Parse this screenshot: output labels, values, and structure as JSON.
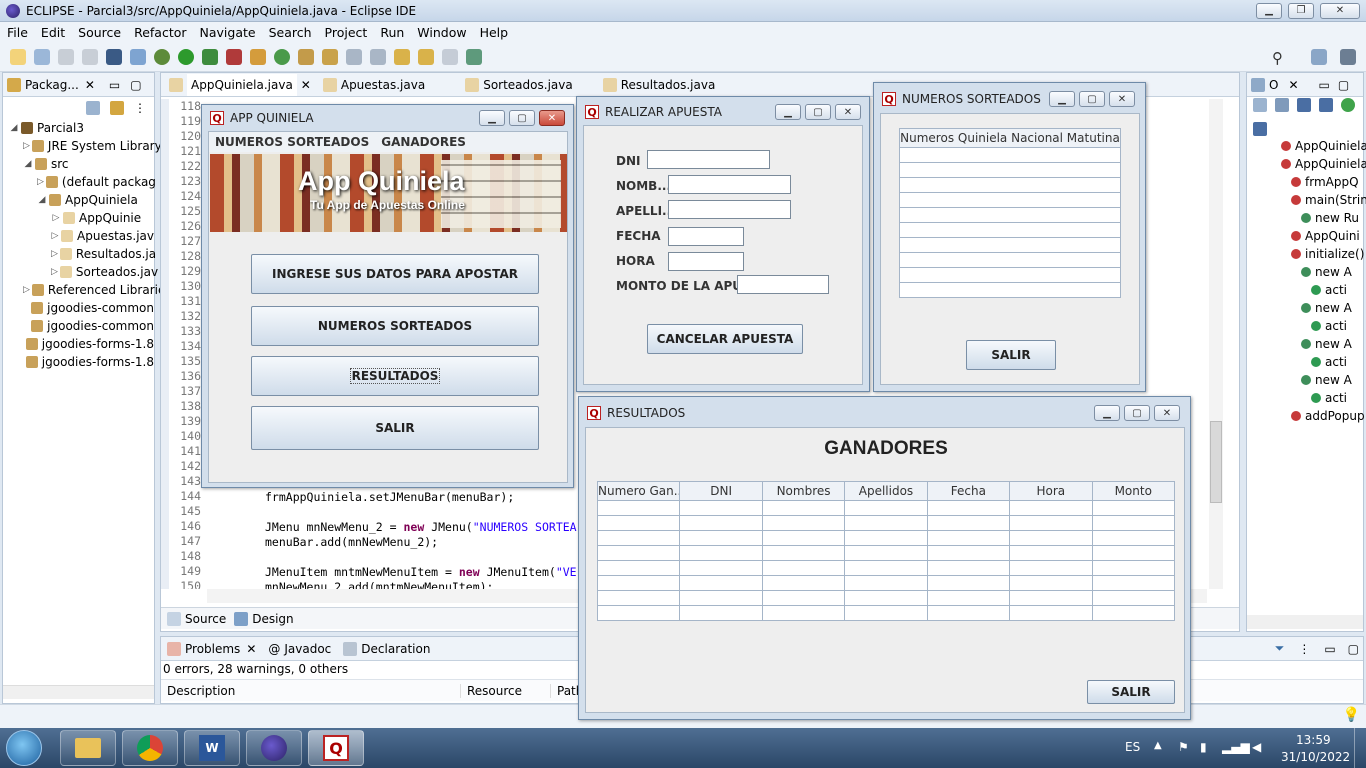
{
  "window": {
    "title": "ECLIPSE - Parcial3/src/AppQuiniela/AppQuiniela.java - Eclipse IDE"
  },
  "menu": [
    "File",
    "Edit",
    "Source",
    "Refactor",
    "Navigate",
    "Search",
    "Project",
    "Run",
    "Window",
    "Help"
  ],
  "package_explorer": {
    "tab": "Packag...",
    "items": [
      {
        "label": "Parcial3",
        "indent": 0,
        "twisty": "◢"
      },
      {
        "label": "JRE System Library",
        "indent": 1,
        "twisty": "▷"
      },
      {
        "label": "src",
        "indent": 1,
        "twisty": "◢"
      },
      {
        "label": "(default packag",
        "indent": 2,
        "twisty": "▷"
      },
      {
        "label": "AppQuiniela",
        "indent": 2,
        "twisty": "◢"
      },
      {
        "label": "AppQuinie",
        "indent": 3,
        "twisty": "▷"
      },
      {
        "label": "Apuestas.jav",
        "indent": 3,
        "twisty": "▷"
      },
      {
        "label": "Resultados.ja",
        "indent": 3,
        "twisty": "▷"
      },
      {
        "label": "Sorteados.jav",
        "indent": 3,
        "twisty": "▷"
      },
      {
        "label": "Referenced Librarie",
        "indent": 1,
        "twisty": "▷"
      },
      {
        "label": "jgoodies-common",
        "indent": 1,
        "twisty": ""
      },
      {
        "label": "jgoodies-common",
        "indent": 1,
        "twisty": ""
      },
      {
        "label": "jgoodies-forms-1.8",
        "indent": 1,
        "twisty": ""
      },
      {
        "label": "jgoodies-forms-1.8",
        "indent": 1,
        "twisty": ""
      }
    ]
  },
  "editor": {
    "tabs": [
      "AppQuiniela.java",
      "Apuestas.java",
      "Sorteados.java",
      "Resultados.java"
    ],
    "line_numbers": [
      "118",
      "119",
      "120",
      "121",
      "122",
      "123",
      "124",
      "125",
      "126",
      "127",
      "128",
      "129",
      "130",
      "131",
      "132",
      "133",
      "134",
      "135",
      "136",
      "137",
      "138",
      "139",
      "140",
      "141",
      "142",
      "143",
      "144",
      "145",
      "146",
      "147",
      "148",
      "149",
      "150"
    ],
    "code": {
      "l144": "frmAppQuiniela.setJMenuBar(menuBar);",
      "l146a": "JMenu mnNewMenu_2 = ",
      "l146b": "new",
      "l146c": " JMenu(",
      "l146d": "\"NUMEROS SORTEA",
      "l147": "menuBar.add(mnNewMenu_2);",
      "l149a": "JMenuItem mntmNewMenuItem = ",
      "l149b": "new",
      "l149c": " JMenuItem(",
      "l149d": "\"VE",
      "l150": "mnNewMenu_2.add(mntmNewMenuItem);"
    },
    "bottom_tabs": [
      "Source",
      "Design"
    ]
  },
  "problems": {
    "tabs": [
      "Problems",
      "Javadoc",
      "Declaration"
    ],
    "summary": "0 errors, 28 warnings, 0 others",
    "columns": [
      "Description",
      "Resource",
      "Path"
    ]
  },
  "outline": {
    "tab": "O",
    "items": [
      {
        "label": "AppQuiniela",
        "indent": 0
      },
      {
        "label": "AppQuiniela",
        "indent": 0
      },
      {
        "label": "frmAppQ",
        "indent": 1
      },
      {
        "label": "main(Strin",
        "indent": 1
      },
      {
        "label": "new Ru",
        "indent": 2
      },
      {
        "label": "AppQuini",
        "indent": 1
      },
      {
        "label": "initialize()",
        "indent": 1
      },
      {
        "label": "new A",
        "indent": 2
      },
      {
        "label": "acti",
        "indent": 3
      },
      {
        "label": "new A",
        "indent": 2
      },
      {
        "label": "acti",
        "indent": 3
      },
      {
        "label": "new A",
        "indent": 2
      },
      {
        "label": "acti",
        "indent": 3
      },
      {
        "label": "new A",
        "indent": 2
      },
      {
        "label": "acti",
        "indent": 3
      },
      {
        "label": "addPopup",
        "indent": 1
      }
    ]
  },
  "app_quiniela": {
    "title": "APP QUINIELA",
    "menu": [
      "NUMEROS SORTEADOS",
      "GANADORES"
    ],
    "banner_title": "App Quiniela",
    "banner_subtitle": "Tu App de Apuestas Online",
    "buttons": [
      "INGRESE SUS DATOS PARA APOSTAR",
      "NUMEROS SORTEADOS",
      "RESULTADOS",
      "SALIR"
    ]
  },
  "realizar_apuesta": {
    "title": "REALIZAR APUESTA",
    "labels": [
      "DNI",
      "NOMB...",
      "APELLI...",
      "FECHA",
      "HORA",
      "MONTO DE LA APUE..."
    ],
    "cancel": "CANCELAR APUESTA"
  },
  "numeros_sorteados": {
    "title": "NUMEROS SORTEADOS",
    "column": "Numeros Quiniela Nacional Matutina",
    "exit": "SALIR"
  },
  "resultados": {
    "title": "RESULTADOS",
    "heading": "GANADORES",
    "columns": [
      "Numero Gan...",
      "DNI",
      "Nombres",
      "Apellidos",
      "Fecha",
      "Hora",
      "Monto"
    ],
    "exit": "SALIR"
  },
  "taskbar": {
    "language": "ES",
    "time": "13:59",
    "date": "31/10/2022"
  },
  "colors": {
    "accent": "#2f5f8f",
    "keyword": "#7f0055",
    "string": "#2a00ff"
  }
}
